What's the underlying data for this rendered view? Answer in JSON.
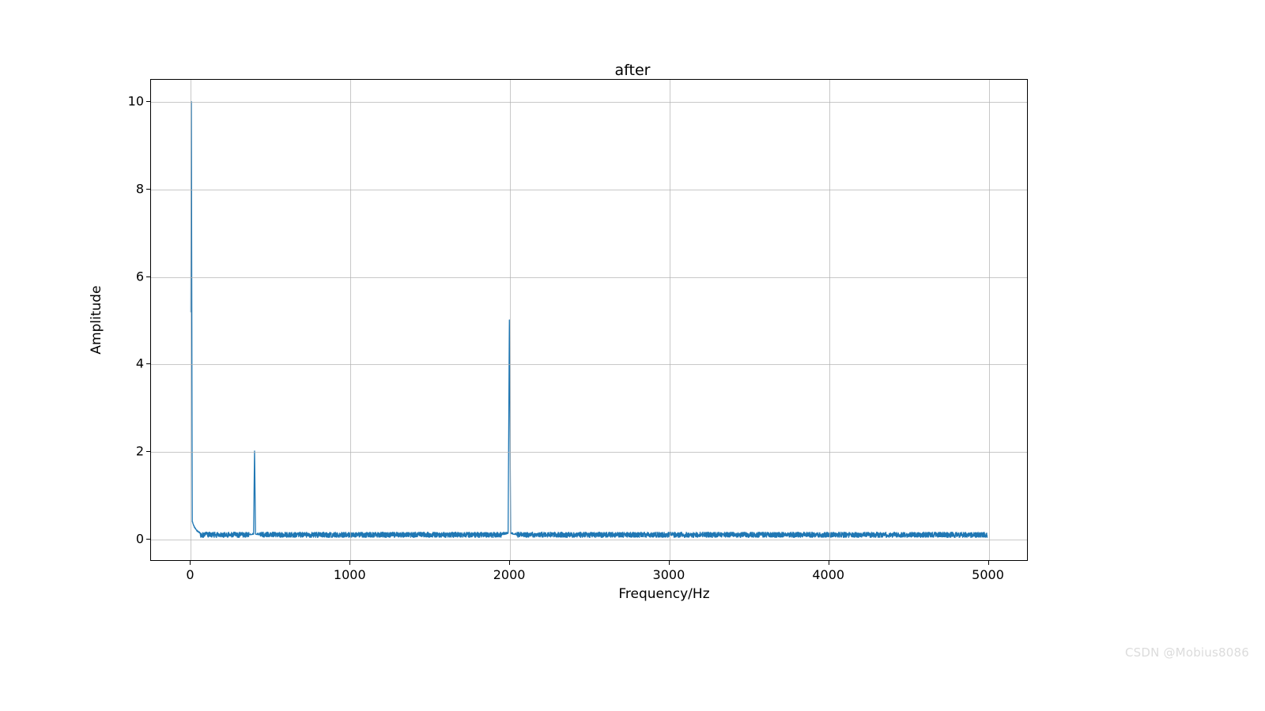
{
  "chart_data": {
    "type": "line",
    "title": "after",
    "xlabel": "Frequency/Hz",
    "ylabel": "Amplitude",
    "xlim": [
      -250,
      5250
    ],
    "ylim": [
      -0.5,
      10.5
    ],
    "xticks": [
      0,
      1000,
      2000,
      3000,
      4000,
      5000
    ],
    "yticks": [
      0,
      2,
      4,
      6,
      8,
      10
    ],
    "noise_floor": 0.08,
    "noise_amplitude": 0.06,
    "peaks": [
      {
        "freq": 3,
        "amp": 10.0,
        "width": 6
      },
      {
        "freq": 400,
        "amp": 2.0,
        "width": 6
      },
      {
        "freq": 2000,
        "amp": 5.0,
        "width": 8
      }
    ],
    "n_points": 5000,
    "line_color": "#1f77b4"
  },
  "watermark": "CSDN @Mobius8086"
}
